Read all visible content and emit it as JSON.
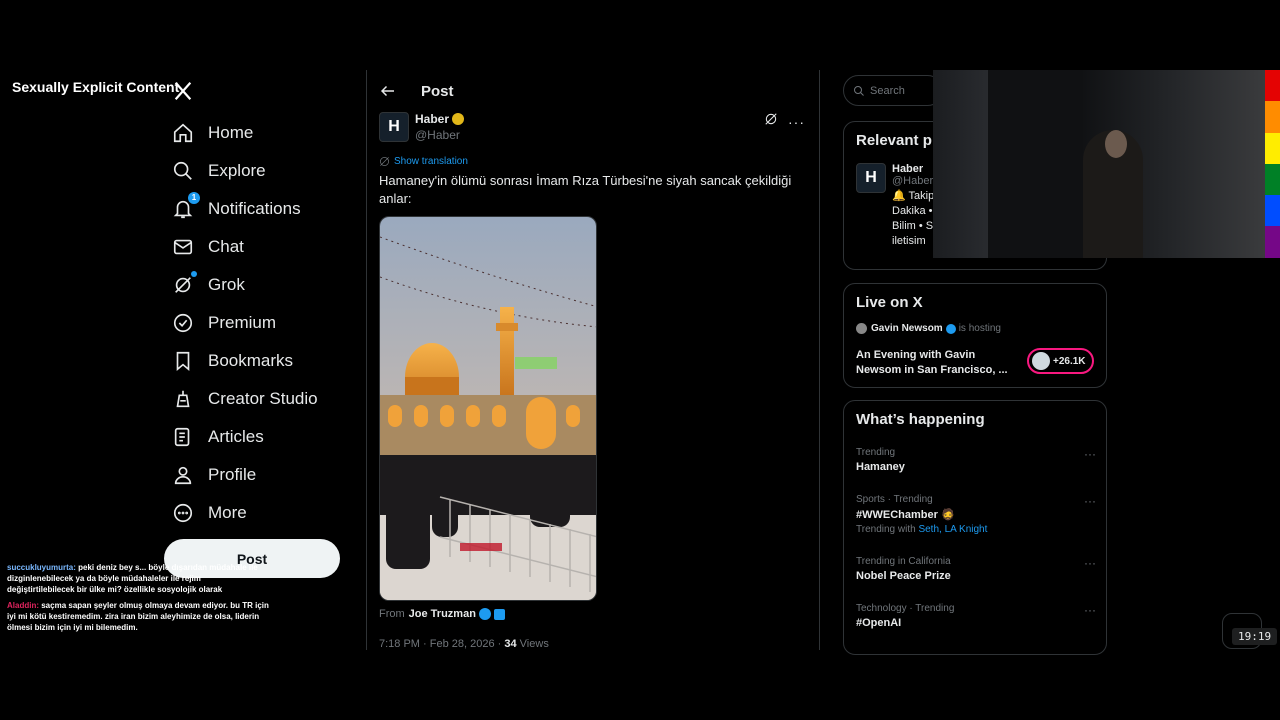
{
  "overlay_label": "Sexually Explicit Content",
  "nav": {
    "items": [
      {
        "label": "Home",
        "icon": "home-icon"
      },
      {
        "label": "Explore",
        "icon": "search-icon"
      },
      {
        "label": "Notifications",
        "icon": "bell-icon",
        "badge": "1"
      },
      {
        "label": "Chat",
        "icon": "mail-icon"
      },
      {
        "label": "Grok",
        "icon": "grok-icon"
      },
      {
        "label": "Premium",
        "icon": "premium-icon"
      },
      {
        "label": "Bookmarks",
        "icon": "bookmark-icon"
      },
      {
        "label": "Creator Studio",
        "icon": "creator-studio-icon"
      },
      {
        "label": "Articles",
        "icon": "articles-icon"
      },
      {
        "label": "Profile",
        "icon": "profile-icon"
      },
      {
        "label": "More",
        "icon": "more-icon"
      }
    ],
    "post_button": "Post"
  },
  "chat": [
    {
      "user": "succukluyumurta:",
      "text": "peki deniz bey s... böyle dışarıdan müdahale ile dizginlenebilecek ya da böyle müdahaleler ile rejim değiştirtilebilecek bir ülke mi? özellikle sosyolojik olarak"
    },
    {
      "user": "Aladdin:",
      "text": "saçma sapan şeyler olmuş olmaya devam ediyor. bu TR için iyi mi kötü kestiremedim. zira iran bizim aleyhimize de olsa, liderin ölmesi bizim için iyi mi bilemedim."
    }
  ],
  "post": {
    "header_title": "Post",
    "author_name": "Haber",
    "author_handle": "@Haber",
    "avatar_letter": "H",
    "show_translation": "Show translation",
    "text": "Hamaney'in ölümü sonrası İmam Rıza Türbesi'ne siyah sancak çekildiği anlar:",
    "from_label": "From",
    "from_name": "Joe Truzman",
    "time": "7:18 PM · Feb 28, 2026 ·",
    "views_count": "34",
    "views_label": "Views"
  },
  "search": {
    "placeholder": "Search"
  },
  "relevant": {
    "title": "Relevant p",
    "name": "Haber",
    "handle": "@Haber",
    "bio": "🔔 Takip Dakika • Bilim • S iletisim"
  },
  "live": {
    "title": "Live on X",
    "host": "Gavin Newsom",
    "hosting": "is hosting",
    "event": "An Evening with Gavin Newsom in San Francisco, ...",
    "count": "+26.1K"
  },
  "happening": {
    "title": "What’s happening",
    "trends": [
      {
        "context": "Trending",
        "title": "Hamaney"
      },
      {
        "context": "Sports · Trending",
        "title": "#WWEChamber 🧔",
        "with_label": "Trending with",
        "with": "Seth, LA Knight"
      },
      {
        "context": "Trending in California",
        "title": "Nobel Peace Prize"
      },
      {
        "context": "Technology · Trending",
        "title": "#OpenAI"
      }
    ]
  },
  "timer": "19:19",
  "colors": {
    "accent": "#1d9bf0",
    "live": "#f91880",
    "gold_badge": "#e2b719"
  }
}
